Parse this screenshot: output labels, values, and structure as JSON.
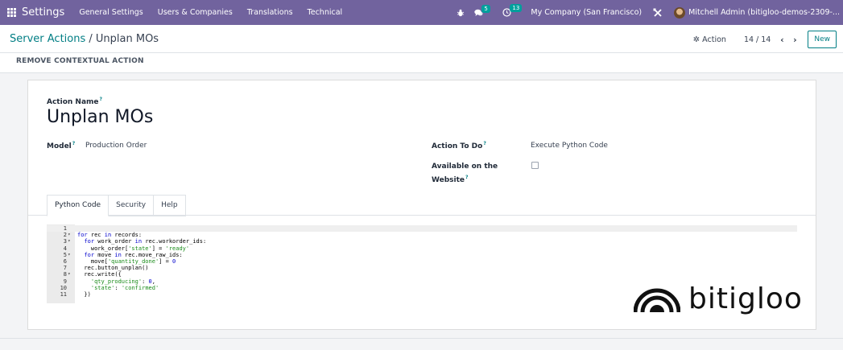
{
  "topbar": {
    "app_name": "Settings",
    "menu": [
      "General Settings",
      "Users & Companies",
      "Translations",
      "Technical"
    ],
    "messages_count": "5",
    "activities_count": "13",
    "company": "My Company (San Francisco)",
    "user": "Mitchell Admin (bitigloo-demos-2309-..."
  },
  "control_panel": {
    "breadcrumb_parent": "Server Actions",
    "breadcrumb_sep": " / ",
    "breadcrumb_current": "Unplan MOs",
    "action_label": "Action",
    "pager": "14 / 14",
    "new_label": "New",
    "remove_label": "REMOVE CONTEXTUAL ACTION"
  },
  "form": {
    "action_name_label": "Action Name",
    "action_name": "Unplan MOs",
    "model_label": "Model",
    "model_value": "Production Order",
    "todo_label": "Action To Do",
    "todo_value": "Execute Python Code",
    "website_label": "Available on the Website",
    "website_checked": false,
    "help_mark": "?"
  },
  "tabs": [
    "Python Code",
    "Security",
    "Help"
  ],
  "code_lines": [
    {
      "n": "1",
      "fold": "",
      "text": ""
    },
    {
      "n": "2",
      "fold": "▾",
      "text": "for rec in records:"
    },
    {
      "n": "3",
      "fold": "▾",
      "text": "  for work_order in rec.workorder_ids:"
    },
    {
      "n": "4",
      "fold": "",
      "text": "    work_order['state'] = 'ready'"
    },
    {
      "n": "5",
      "fold": "▾",
      "text": "  for move in rec.move_raw_ids:"
    },
    {
      "n": "6",
      "fold": "",
      "text": "    move['quantity_done'] = 0"
    },
    {
      "n": "7",
      "fold": "",
      "text": "  rec.button_unplan()"
    },
    {
      "n": "8",
      "fold": "▾",
      "text": "  rec.write({"
    },
    {
      "n": "9",
      "fold": "",
      "text": "    'qty_producing': 0,"
    },
    {
      "n": "10",
      "fold": "",
      "text": "    'state': 'confirmed'"
    },
    {
      "n": "11",
      "fold": "",
      "text": "  })"
    }
  ],
  "watermark": "bitigloo",
  "colors": {
    "topbar": "#71639e",
    "accent": "#017e84"
  }
}
